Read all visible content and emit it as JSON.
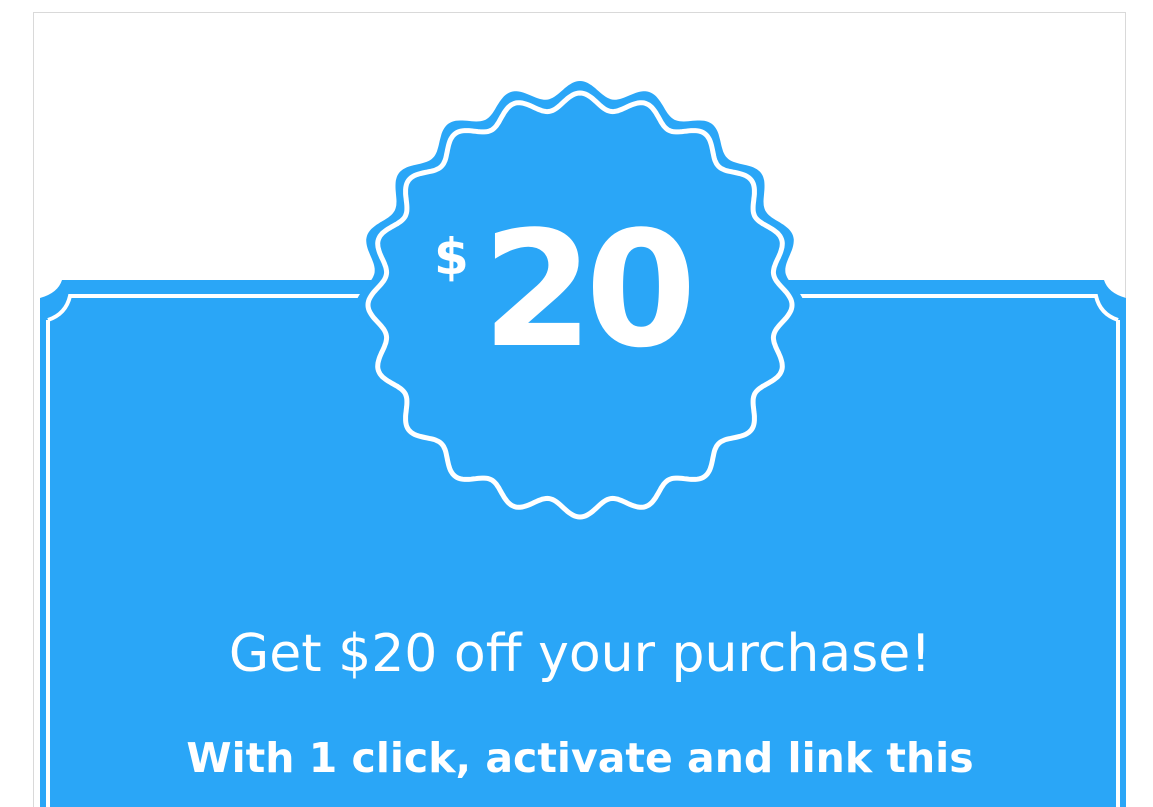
{
  "coupon": {
    "currency_symbol": "$",
    "amount": "20",
    "headline": "Get $20 off your purchase!",
    "subline": "With 1 click, activate and link this",
    "accent_color": "#2aa6f7",
    "text_color": "#ffffff"
  },
  "icons": {
    "badge": "scalloped-badge-icon"
  }
}
